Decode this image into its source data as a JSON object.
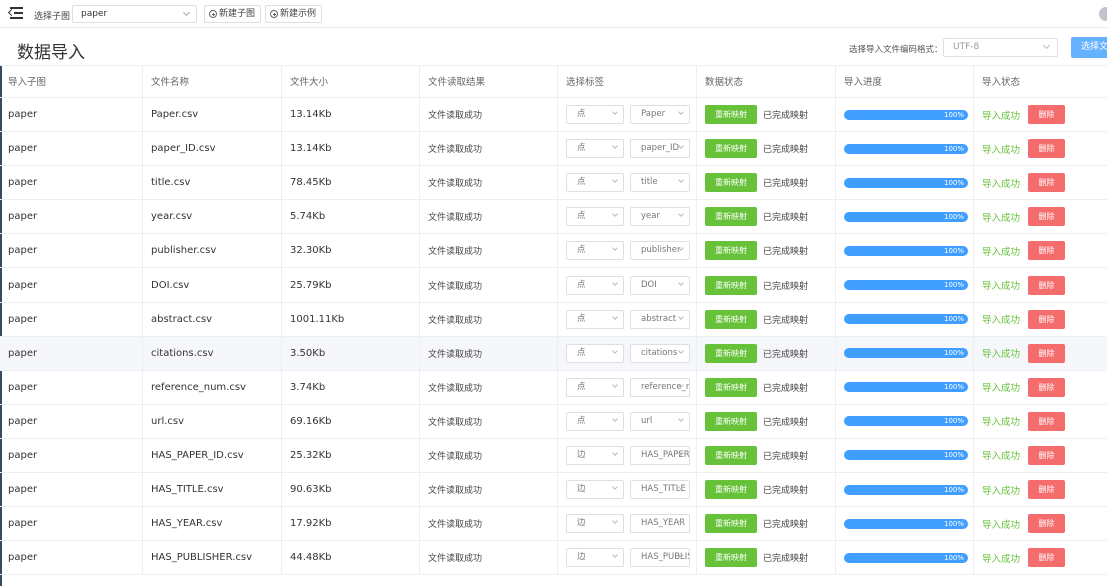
{
  "topbar": {
    "subgraph_label": "选择子图",
    "subgraph_value": "paper",
    "new_subgraph": "新建子图",
    "new_example": "新建示例"
  },
  "header": {
    "title": "数据导入",
    "encoding_label": "选择导入文件编码格式：",
    "encoding_value": "UTF-8",
    "choose_file": "选择文件"
  },
  "columns": [
    "导入子图",
    "文件名称",
    "文件大小",
    "文件读取结果",
    "选择标签",
    "数据状态",
    "导入进度",
    "导入状态"
  ],
  "rows": [
    {
      "graph": "paper",
      "file": "Paper.csv",
      "size": "13.14Kb",
      "read": "文件读取成功",
      "type": "点",
      "label": "Paper",
      "remap": "重新映射",
      "status": "已完成映射",
      "progress": "100%",
      "result": "导入成功",
      "del": "删除"
    },
    {
      "graph": "paper",
      "file": "paper_ID.csv",
      "size": "13.14Kb",
      "read": "文件读取成功",
      "type": "点",
      "label": "paper_ID",
      "remap": "重新映射",
      "status": "已完成映射",
      "progress": "100%",
      "result": "导入成功",
      "del": "删除"
    },
    {
      "graph": "paper",
      "file": "title.csv",
      "size": "78.45Kb",
      "read": "文件读取成功",
      "type": "点",
      "label": "title",
      "remap": "重新映射",
      "status": "已完成映射",
      "progress": "100%",
      "result": "导入成功",
      "del": "删除"
    },
    {
      "graph": "paper",
      "file": "year.csv",
      "size": "5.74Kb",
      "read": "文件读取成功",
      "type": "点",
      "label": "year",
      "remap": "重新映射",
      "status": "已完成映射",
      "progress": "100%",
      "result": "导入成功",
      "del": "删除"
    },
    {
      "graph": "paper",
      "file": "publisher.csv",
      "size": "32.30Kb",
      "read": "文件读取成功",
      "type": "点",
      "label": "publisher",
      "remap": "重新映射",
      "status": "已完成映射",
      "progress": "100%",
      "result": "导入成功",
      "del": "删除"
    },
    {
      "graph": "paper",
      "file": "DOI.csv",
      "size": "25.79Kb",
      "read": "文件读取成功",
      "type": "点",
      "label": "DOI",
      "remap": "重新映射",
      "status": "已完成映射",
      "progress": "100%",
      "result": "导入成功",
      "del": "删除"
    },
    {
      "graph": "paper",
      "file": "abstract.csv",
      "size": "1001.11Kb",
      "read": "文件读取成功",
      "type": "点",
      "label": "abstract",
      "remap": "重新映射",
      "status": "已完成映射",
      "progress": "100%",
      "result": "导入成功",
      "del": "删除"
    },
    {
      "graph": "paper",
      "file": "citations.csv",
      "size": "3.50Kb",
      "read": "文件读取成功",
      "type": "点",
      "label": "citations",
      "remap": "重新映射",
      "status": "已完成映射",
      "progress": "100%",
      "result": "导入成功",
      "del": "删除"
    },
    {
      "graph": "paper",
      "file": "reference_num.csv",
      "size": "3.74Kb",
      "read": "文件读取成功",
      "type": "点",
      "label": "reference_num",
      "remap": "重新映射",
      "status": "已完成映射",
      "progress": "100%",
      "result": "导入成功",
      "del": "删除"
    },
    {
      "graph": "paper",
      "file": "url.csv",
      "size": "69.16Kb",
      "read": "文件读取成功",
      "type": "点",
      "label": "url",
      "remap": "重新映射",
      "status": "已完成映射",
      "progress": "100%",
      "result": "导入成功",
      "del": "删除"
    },
    {
      "graph": "paper",
      "file": "HAS_PAPER_ID.csv",
      "size": "25.32Kb",
      "read": "文件读取成功",
      "type": "边",
      "label": "HAS_PAPER_ID",
      "remap": "重新映射",
      "status": "已完成映射",
      "progress": "100%",
      "result": "导入成功",
      "del": "删除"
    },
    {
      "graph": "paper",
      "file": "HAS_TITLE.csv",
      "size": "90.63Kb",
      "read": "文件读取成功",
      "type": "边",
      "label": "HAS_TITLE",
      "remap": "重新映射",
      "status": "已完成映射",
      "progress": "100%",
      "result": "导入成功",
      "del": "删除"
    },
    {
      "graph": "paper",
      "file": "HAS_YEAR.csv",
      "size": "17.92Kb",
      "read": "文件读取成功",
      "type": "边",
      "label": "HAS_YEAR",
      "remap": "重新映射",
      "status": "已完成映射",
      "progress": "100%",
      "result": "导入成功",
      "del": "删除"
    },
    {
      "graph": "paper",
      "file": "HAS_PUBLISHER.csv",
      "size": "44.48Kb",
      "read": "文件读取成功",
      "type": "边",
      "label": "HAS_PUBLISHER",
      "remap": "重新映射",
      "status": "已完成映射",
      "progress": "100%",
      "result": "导入成功",
      "del": "删除"
    }
  ],
  "highlight_row": 7,
  "colors": {
    "success": "#67c23a",
    "danger": "#f56c6c",
    "primary": "#409eff",
    "nav": "#3a4a63"
  }
}
